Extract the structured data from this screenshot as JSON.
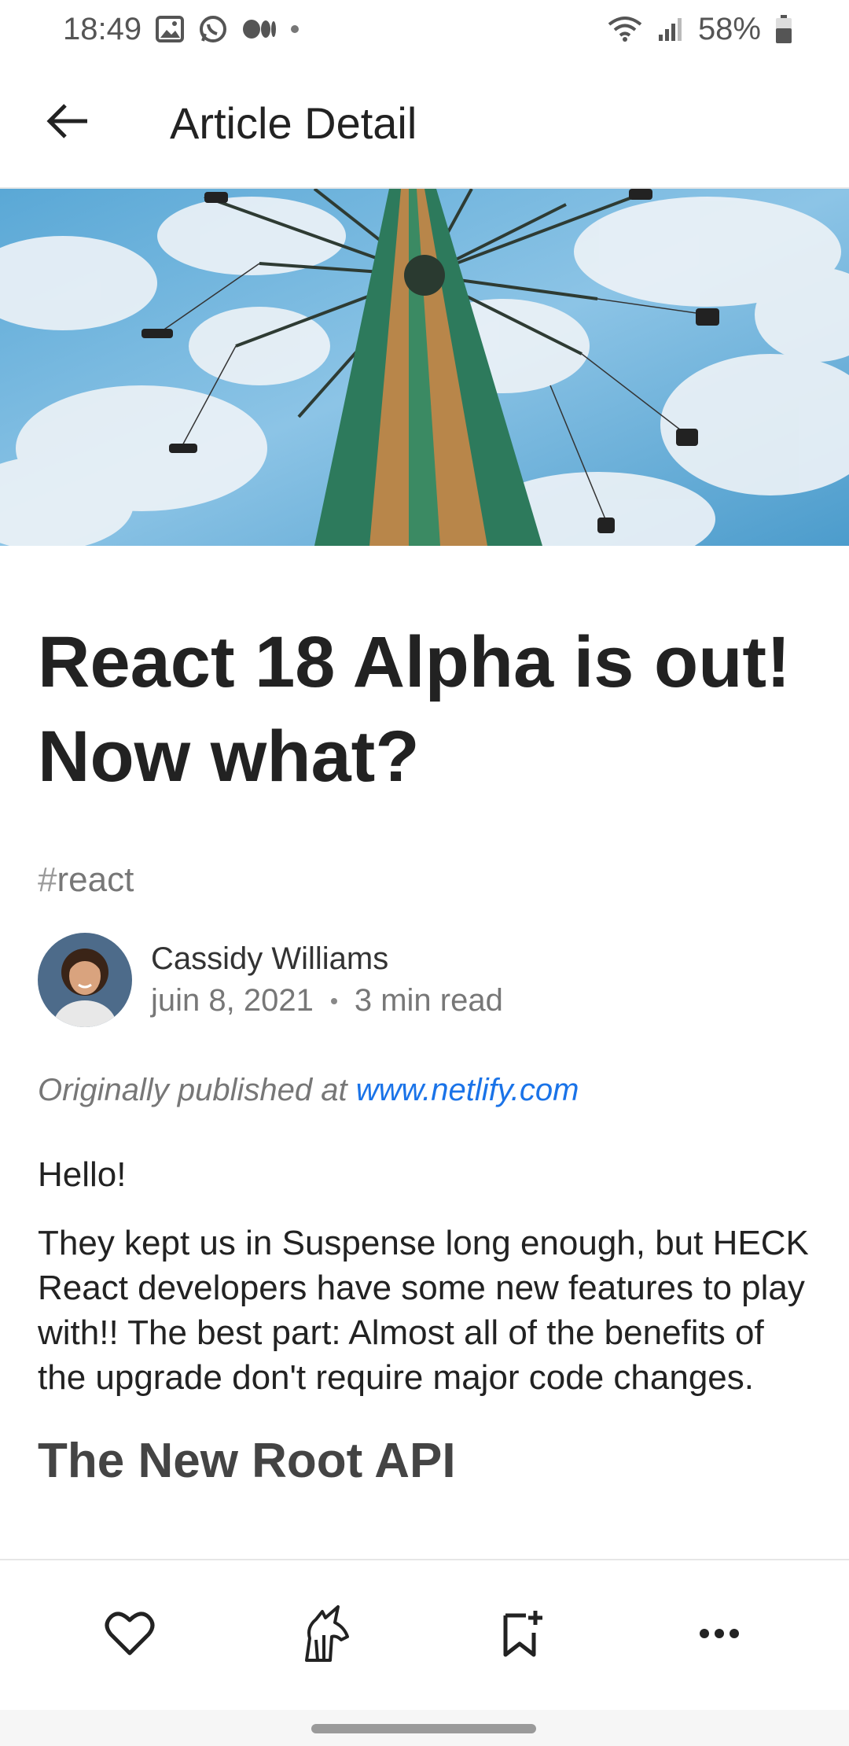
{
  "status_bar": {
    "time": "18:49",
    "battery": "58%",
    "icons_left": [
      "gallery-icon",
      "whatsapp-icon",
      "medium-icon",
      "dot-icon"
    ],
    "icons_right": [
      "wifi-icon",
      "signal-icon",
      "battery-icon"
    ]
  },
  "app_bar": {
    "title": "Article Detail",
    "back_icon": "arrow-left-icon"
  },
  "article": {
    "title": "React 18 Alpha is out! Now what?",
    "tag_hash": "#",
    "tag_name": "react",
    "author": {
      "name": "Cassidy Williams",
      "date": "juin 8, 2021",
      "read_time": "3 min read"
    },
    "origin_prefix": "Originally published at",
    "origin_link": "www.netlify.com",
    "hello": "Hello!",
    "body": "They kept us in Suspense long enough, but HECK React developers have some new features to play with!! The best part: Almost all of the benefits of the upgrade don't require major code changes.",
    "section_heading": "The New Root API"
  },
  "bottom_bar": {
    "actions": [
      "heart-icon",
      "unicorn-icon",
      "bookmark-add-icon",
      "more-icon"
    ]
  },
  "colors": {
    "link": "#1a73e8",
    "text": "#222222",
    "muted": "#777777"
  }
}
